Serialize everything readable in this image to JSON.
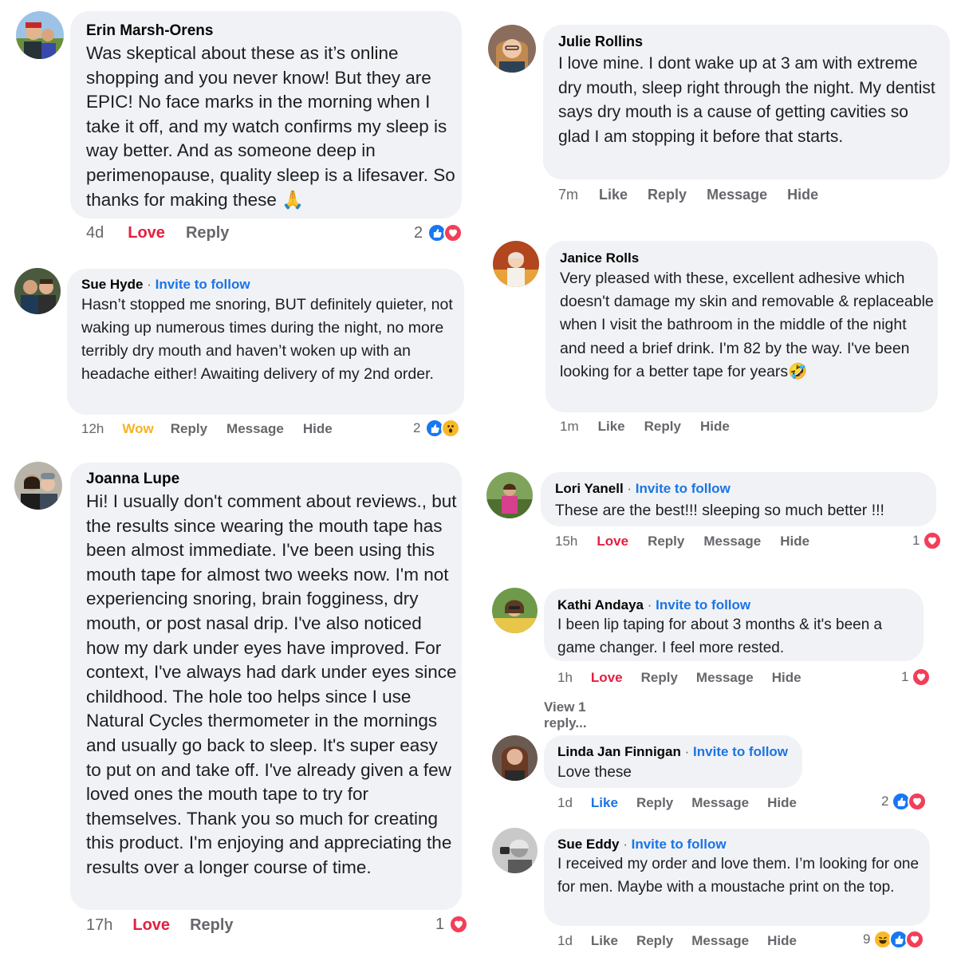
{
  "comments": [
    {
      "author": "Erin Marsh-Orens",
      "invite": "",
      "text": "Was skeptical about these as it’s online shopping and you never know! But they are EPIC! No face marks in the morning when I take it off, and my watch confirms my sleep is way better. And as someone deep in perimenopause, quality sleep is a lifesaver. So thanks for making these 🙏",
      "time": "4d",
      "reacted": "Love",
      "actions": [
        "Reply"
      ],
      "reaction_count": "2",
      "reaction_icons": [
        "like-icon",
        "love-icon"
      ]
    },
    {
      "author": "Sue Hyde",
      "invite": "Invite to follow",
      "text": "Hasn’t stopped me snoring, BUT definitely quieter, not waking up numerous times during the night, no more terribly dry mouth and haven’t woken up with an headache either!  Awaiting delivery of my 2nd order.",
      "time": "12h",
      "reacted": "Wow",
      "actions": [
        "Reply",
        "Message",
        "Hide"
      ],
      "reaction_count": "2",
      "reaction_icons": [
        "like-icon",
        "wow-icon"
      ]
    },
    {
      "author": "Joanna Lupe",
      "invite": "",
      "text": "Hi! I usually don't comment about reviews., but the results since wearing the mouth tape has been almost immediate. I've been using this mouth tape for almost two weeks now. I'm not experiencing snoring, brain fogginess, dry mouth, or post nasal drip. I've also noticed how my dark under eyes have improved. For context, I've always had dark under eyes since childhood. The hole too helps since I use Natural Cycles thermometer in the mornings and usually go back to sleep. It's super easy to put on and take off. I've already given a few loved ones the mouth tape to try for themselves. Thank you so much for creating this product. I'm enjoying and appreciating the results over a longer course of time.",
      "time": "17h",
      "reacted": "Love",
      "actions": [
        "Reply"
      ],
      "reaction_count": "1",
      "reaction_icons": [
        "love-icon"
      ]
    },
    {
      "author": "Julie Rollins",
      "invite": "",
      "text": "I love mine. I dont wake up at 3 am with extreme dry mouth, sleep right through the night. My dentist says dry mouth is a cause of getting cavities so glad I am stopping it before that starts.",
      "time": "7m",
      "reacted": "",
      "actions": [
        "Like",
        "Reply",
        "Message",
        "Hide"
      ],
      "reaction_count": "",
      "reaction_icons": []
    },
    {
      "author": "Janice Rolls",
      "invite": "",
      "text": "Very pleased with these, excellent adhesive which doesn't damage my skin and removable & replaceable when I visit the bathroom in the middle of the night and need a brief drink. I'm 82 by the way. I've been looking for a better tape for years🤣",
      "time": "1m",
      "reacted": "",
      "actions": [
        "Like",
        "Reply",
        "Hide"
      ],
      "reaction_count": "",
      "reaction_icons": []
    },
    {
      "author": "Lori Yanell",
      "invite": "Invite to follow",
      "text": "These are the best!!!  sleeping so much better !!!",
      "time": "15h",
      "reacted": "Love",
      "actions": [
        "Reply",
        "Message",
        "Hide"
      ],
      "reaction_count": "1",
      "reaction_icons": [
        "love-icon"
      ]
    },
    {
      "author": "Kathi Andaya",
      "invite": "Invite to follow",
      "text": "I been lip taping for about 3 months & it's been a game changer.  I feel more rested.",
      "time": "1h",
      "reacted": "Love",
      "actions": [
        "Reply",
        "Message",
        "Hide"
      ],
      "reaction_count": "1",
      "reaction_icons": [
        "love-icon"
      ],
      "view_replies": "View 1 reply..."
    },
    {
      "author": "Linda Jan Finnigan",
      "invite": "Invite to follow",
      "text": "Love these",
      "time": "1d",
      "reacted": "Like",
      "actions": [
        "Reply",
        "Message",
        "Hide"
      ],
      "reaction_count": "2",
      "reaction_icons": [
        "like-icon",
        "love-icon"
      ]
    },
    {
      "author": "Sue Eddy",
      "invite": "Invite to follow",
      "text": "I received my order and love them. I’m looking for one for men. Maybe with a moustache print on the top.",
      "time": "1d",
      "reacted": "",
      "actions": [
        "Like",
        "Reply",
        "Message",
        "Hide"
      ],
      "reaction_count": "9",
      "reaction_icons": [
        "haha-icon",
        "like-icon",
        "love-icon"
      ]
    }
  ],
  "colors": {
    "bubble": "#f0f2f5",
    "link_blue": "#1b74e4",
    "love_red": "#e41e3f",
    "wow_yellow": "#f7b125",
    "meta_gray": "#65676b"
  }
}
